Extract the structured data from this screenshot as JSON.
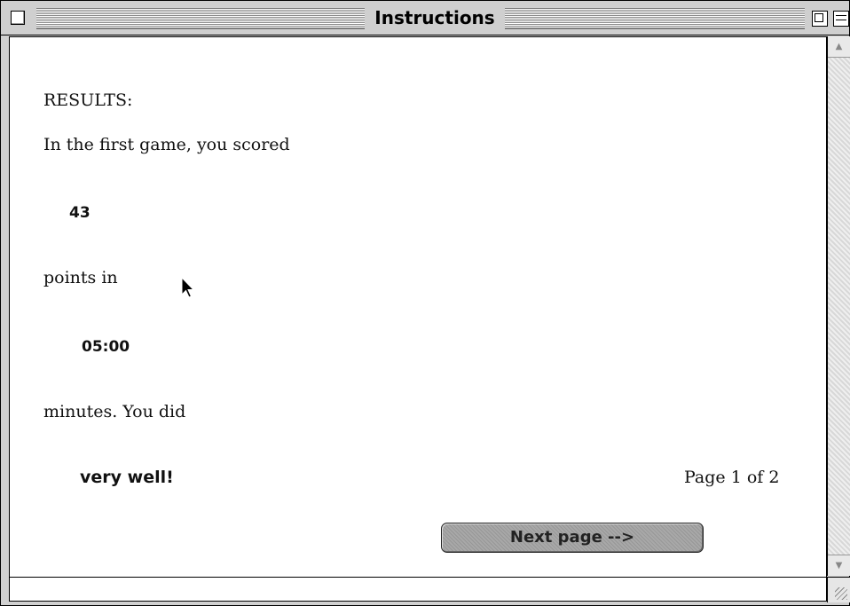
{
  "window": {
    "title": "Instructions"
  },
  "content": {
    "heading": "RESULTS:",
    "line1": "In the first game, you scored",
    "score": "43",
    "line2": "points in",
    "time": "05:00",
    "line3": "minutes.  You did",
    "rating": "very well!",
    "page_indicator": "Page 1 of 2",
    "next_button_label": "Next page -->"
  },
  "scrollbar": {
    "up_arrow": "▲",
    "down_arrow": "▼"
  }
}
